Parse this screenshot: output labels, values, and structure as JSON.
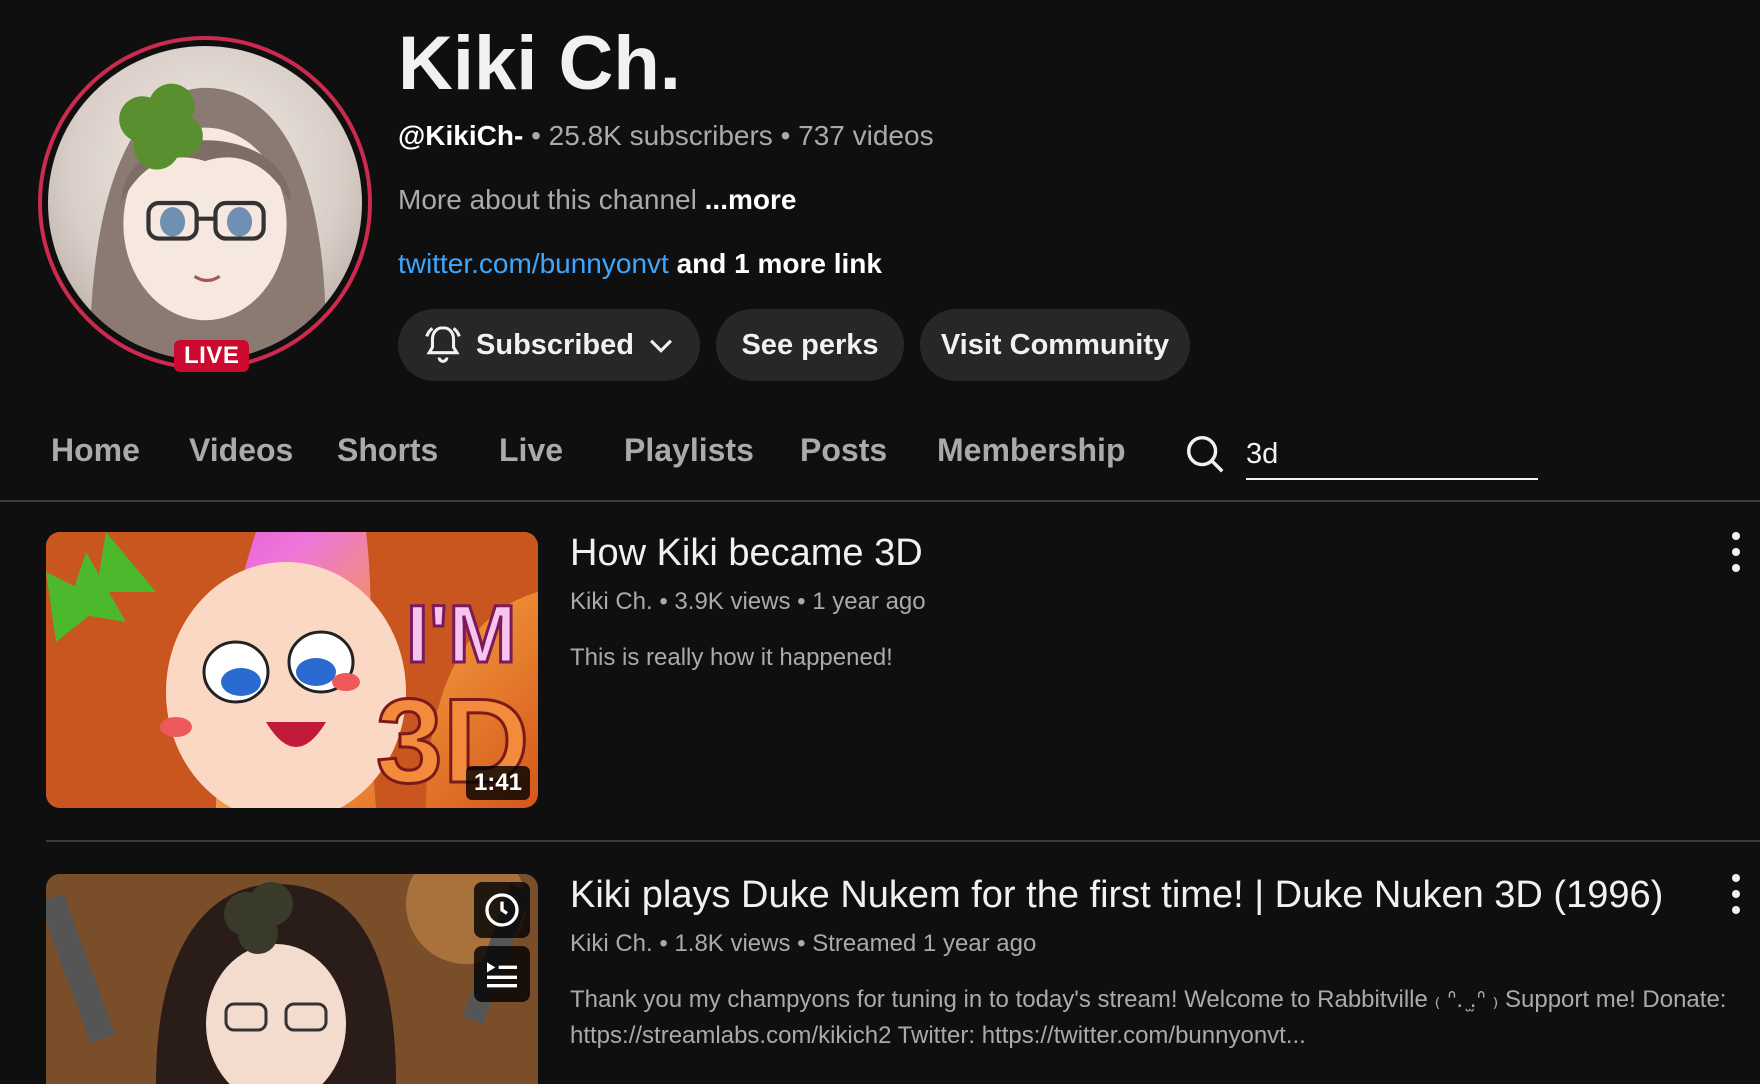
{
  "channel": {
    "name": "Kiki Ch.",
    "handle": "@KikiCh-",
    "meta": " • 25.8K subscribers • 737 videos",
    "live_label": "LIVE",
    "about_text": "More about this channel ",
    "about_more": "...more",
    "link_url": "twitter.com/bunnyonvt",
    "link_extra": " and 1 more link"
  },
  "actions": {
    "subscribed": "Subscribed",
    "perks": "See perks",
    "community": "Visit Community"
  },
  "tabs": [
    "Home",
    "Videos",
    "Shorts",
    "Live",
    "Playlists",
    "Posts",
    "Membership"
  ],
  "search": {
    "value": "3d"
  },
  "videos": [
    {
      "title": "How Kiki became 3D",
      "meta": "Kiki Ch. • 3.9K views • 1 year ago",
      "description": "This is really how it happened!",
      "duration": "1:41",
      "thumb_text_1": "I'M",
      "thumb_text_2": "3D"
    },
    {
      "title": "Kiki plays Duke Nukem for the first time! | Duke Nuken 3D (1996)",
      "meta": "Kiki Ch. • 1.8K views • Streamed 1 year ago",
      "description": "Thank you my champyons for tuning in to today's stream! Welcome to Rabbitville ₍ ᐢ. ̫.ᐢ ₎ Support me! Donate: https://streamlabs.com/kikich2 Twitter: https://twitter.com/bunnyonvt..."
    }
  ],
  "colors": {
    "background": "#0f0f0f",
    "accent_link": "#3ea6ff",
    "live_red": "#cc0a2f",
    "ring": "#cc2a4e"
  }
}
